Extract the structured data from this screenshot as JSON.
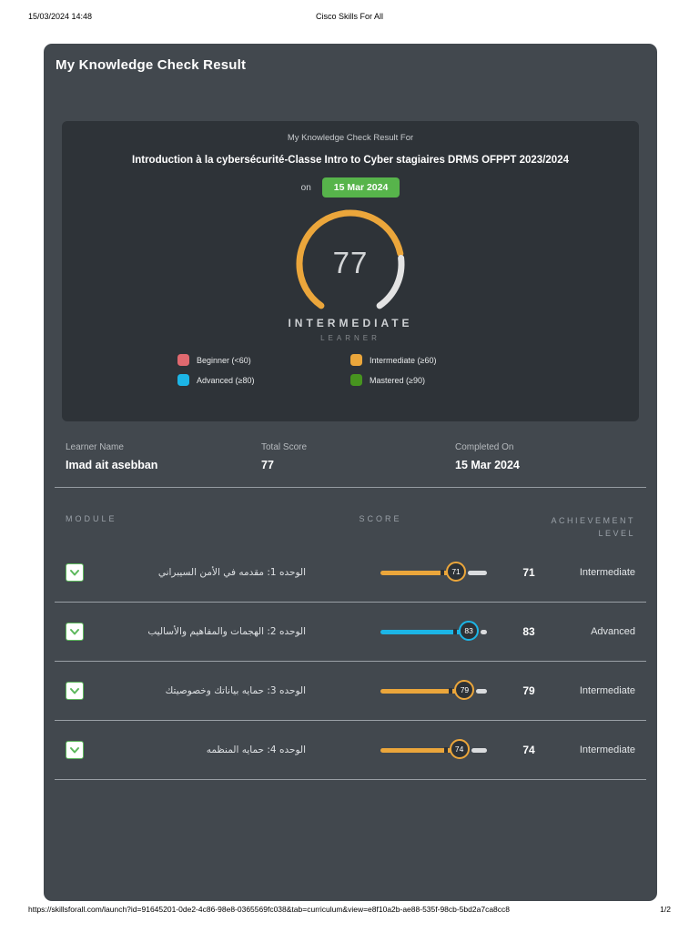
{
  "page_header": {
    "datetime": "15/03/2024 14:48",
    "site_title": "Cisco Skills For All"
  },
  "report": {
    "title": "My Knowledge Check Result",
    "summary": {
      "heading": "My Knowledge Check Result For",
      "course_title": "Introduction à la cybersécurité-Classe Intro to Cyber stagiaires DRMS OFPPT 2023/2024",
      "on_label": "on",
      "date_badge": "15 Mar 2024",
      "score": 77,
      "achievement": "INTERMEDIATE",
      "achievement_sub": "LEARNER",
      "legend": [
        {
          "label": "Beginner (<60)",
          "color": "#e0696f"
        },
        {
          "label": "Intermediate (≥60)",
          "color": "#eba63b"
        },
        {
          "label": "Advanced (≥80)",
          "color": "#1cb5e6"
        },
        {
          "label": "Mastered (≥90)",
          "color": "#47941f"
        }
      ]
    },
    "learner": {
      "name_label": "Learner Name",
      "name": "Imad ait asebban",
      "score_label": "Total Score",
      "score": "77",
      "completed_label": "Completed On",
      "completed": "15 Mar 2024"
    },
    "table": {
      "headers": {
        "module": "MODULE",
        "score": "SCORE",
        "level": "ACHIEVEMENT LEVEL"
      },
      "modules": [
        {
          "name": "الوحده 1: مقدمه في الأمن السيبراني",
          "score": 71,
          "level": "Intermediate"
        },
        {
          "name": "الوحده 2: الهجمات والمفاهيم والأساليب",
          "score": 83,
          "level": "Advanced"
        },
        {
          "name": "الوحده 3: حمايه بياناتك وخصوصيتك",
          "score": 79,
          "level": "Intermediate"
        },
        {
          "name": "الوحده 4: حمايه المنظمه",
          "score": 74,
          "level": "Intermediate"
        }
      ]
    }
  },
  "colors": {
    "beginner": "#e0696f",
    "intermediate": "#eba63b",
    "advanced": "#1cb5e6",
    "mastered": "#47941f",
    "badge_green": "#57b44b",
    "gauge_rest": "#e3e3e3"
  },
  "footer": {
    "url": "https://skillsforall.com/launch?id=91645201-0de2-4c86-98e8-0365569fc038&tab=curriculum&view=e8f10a2b-ae88-535f-98cb-5bd2a7ca8cc8",
    "page": "1/2"
  }
}
